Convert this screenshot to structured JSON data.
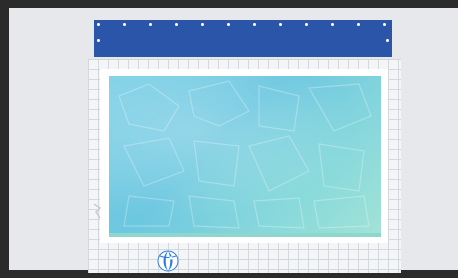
{
  "colors": {
    "frame": "#2b2b2b",
    "playfield": "#e6e8eb",
    "cover": "#2b55a8",
    "deck_tile": "#f4f5f6",
    "deck_grout": "#d4d8dc",
    "water": "#6cc7e0",
    "ball_blue": "#2c7be0",
    "ball_white": "#ffffff"
  },
  "icons": {
    "beach_ball": "beach-ball-icon",
    "deck_marker": "deck-marker-icon"
  }
}
